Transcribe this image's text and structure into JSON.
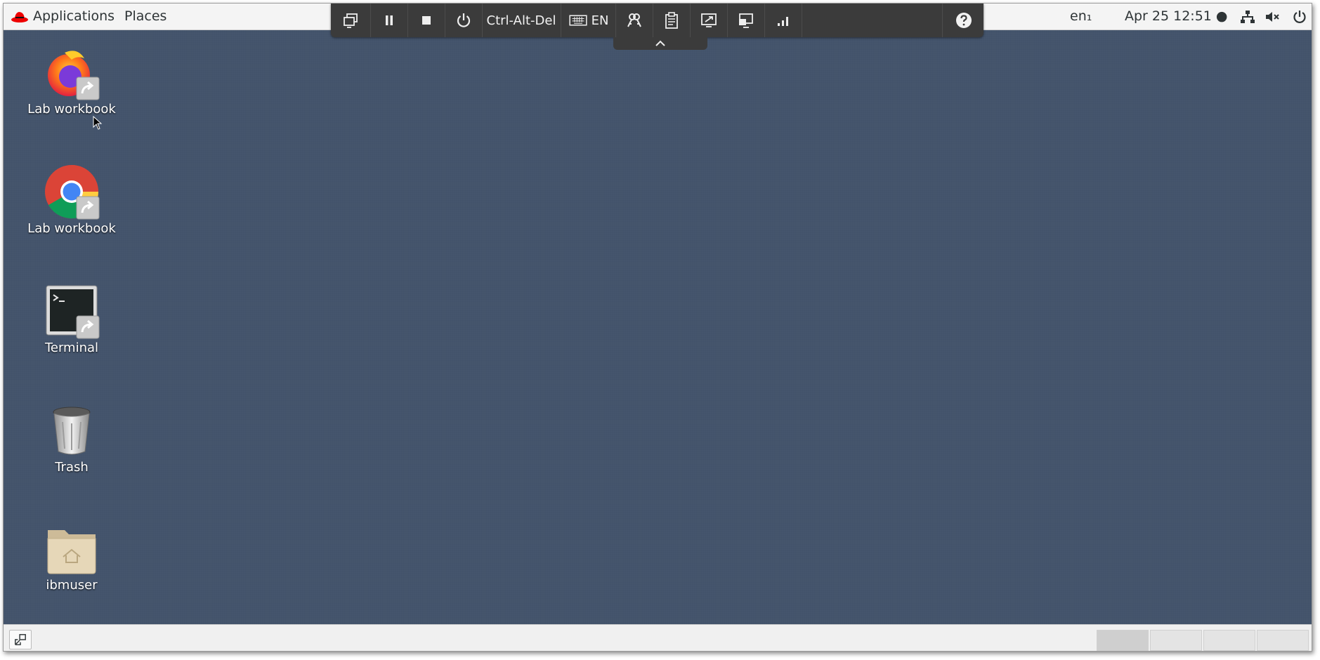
{
  "topbar": {
    "applications_label": "Applications",
    "places_label": "Places",
    "language_label": "en₁",
    "clock_label": "Apr 25  12:51 ●",
    "tray_icons": [
      "network-icon",
      "volume-muted-icon",
      "power-icon"
    ]
  },
  "vm_toolbar": {
    "buttons": [
      {
        "icon": "switch-display-icon"
      },
      {
        "icon": "pause-icon"
      },
      {
        "icon": "stop-icon"
      },
      {
        "icon": "power-icon"
      },
      {
        "label": "Ctrl-Alt-Del"
      },
      {
        "icon": "keyboard-icon",
        "label": "EN"
      },
      {
        "icon": "keys-icon"
      },
      {
        "icon": "clipboard-icon"
      },
      {
        "icon": "fullscreen-icon"
      },
      {
        "icon": "monitors-icon"
      },
      {
        "icon": "signal-bars-icon"
      },
      {
        "icon": "help-icon"
      }
    ],
    "ctrl_alt_del_label": "Ctrl-Alt-Del",
    "keyboard_label": "EN"
  },
  "desktop": {
    "icons": [
      {
        "label": "Lab workbook",
        "icon": "firefox-icon"
      },
      {
        "label": "Lab workbook",
        "icon": "chrome-icon"
      },
      {
        "label": "Terminal",
        "icon": "terminal-icon"
      },
      {
        "label": "Trash",
        "icon": "trash-icon"
      },
      {
        "label": "ibmuser",
        "icon": "home-folder-icon"
      }
    ]
  },
  "bottombar": {
    "workspaces": 4,
    "active_workspace": 1
  },
  "colors": {
    "desktop_bg": "#43536b",
    "vm_toolbar_bg": "#3b3b3b",
    "topbar_bg": "#f4f4f4"
  }
}
